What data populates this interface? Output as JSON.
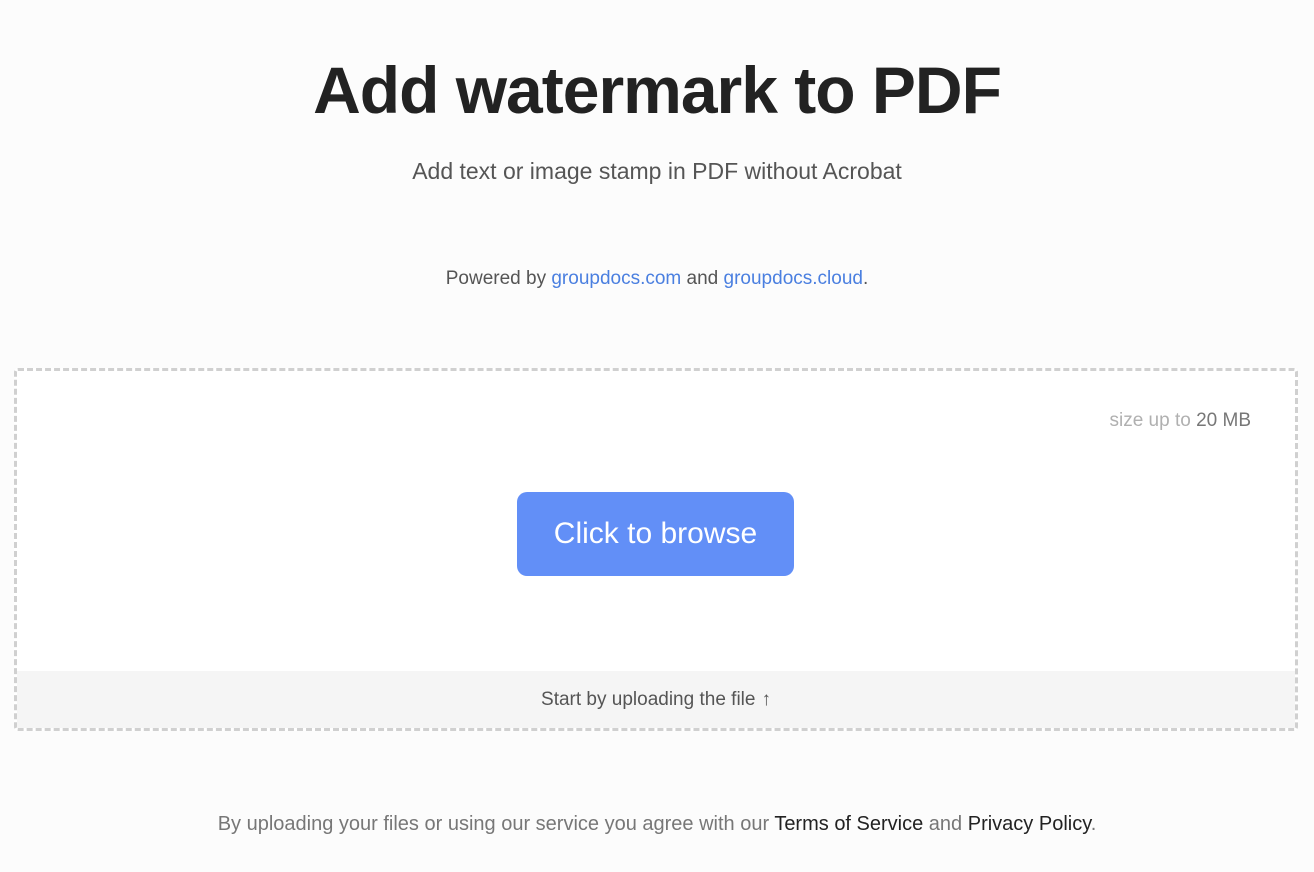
{
  "header": {
    "title": "Add watermark to PDF",
    "subtitle": "Add text or image stamp in PDF without Acrobat"
  },
  "powered": {
    "prefix": "Powered by ",
    "link1": "groupdocs.com",
    "middle": " and ",
    "link2": "groupdocs.cloud",
    "suffix": "."
  },
  "dropzone": {
    "size_prefix": "size up to ",
    "size_value": "20 MB",
    "browse_label": "Click to browse",
    "hint": "Start by uploading the file",
    "hint_icon": "arrow-up-icon",
    "hint_glyph": "↑"
  },
  "footer": {
    "prefix": "By uploading your files or using our service you agree with our ",
    "terms": "Terms of Service",
    "middle": " and ",
    "privacy": "Privacy Policy",
    "suffix": "."
  },
  "colors": {
    "accent": "#628ff7",
    "link": "#4a7fe0",
    "background": "#fcfcfc"
  }
}
